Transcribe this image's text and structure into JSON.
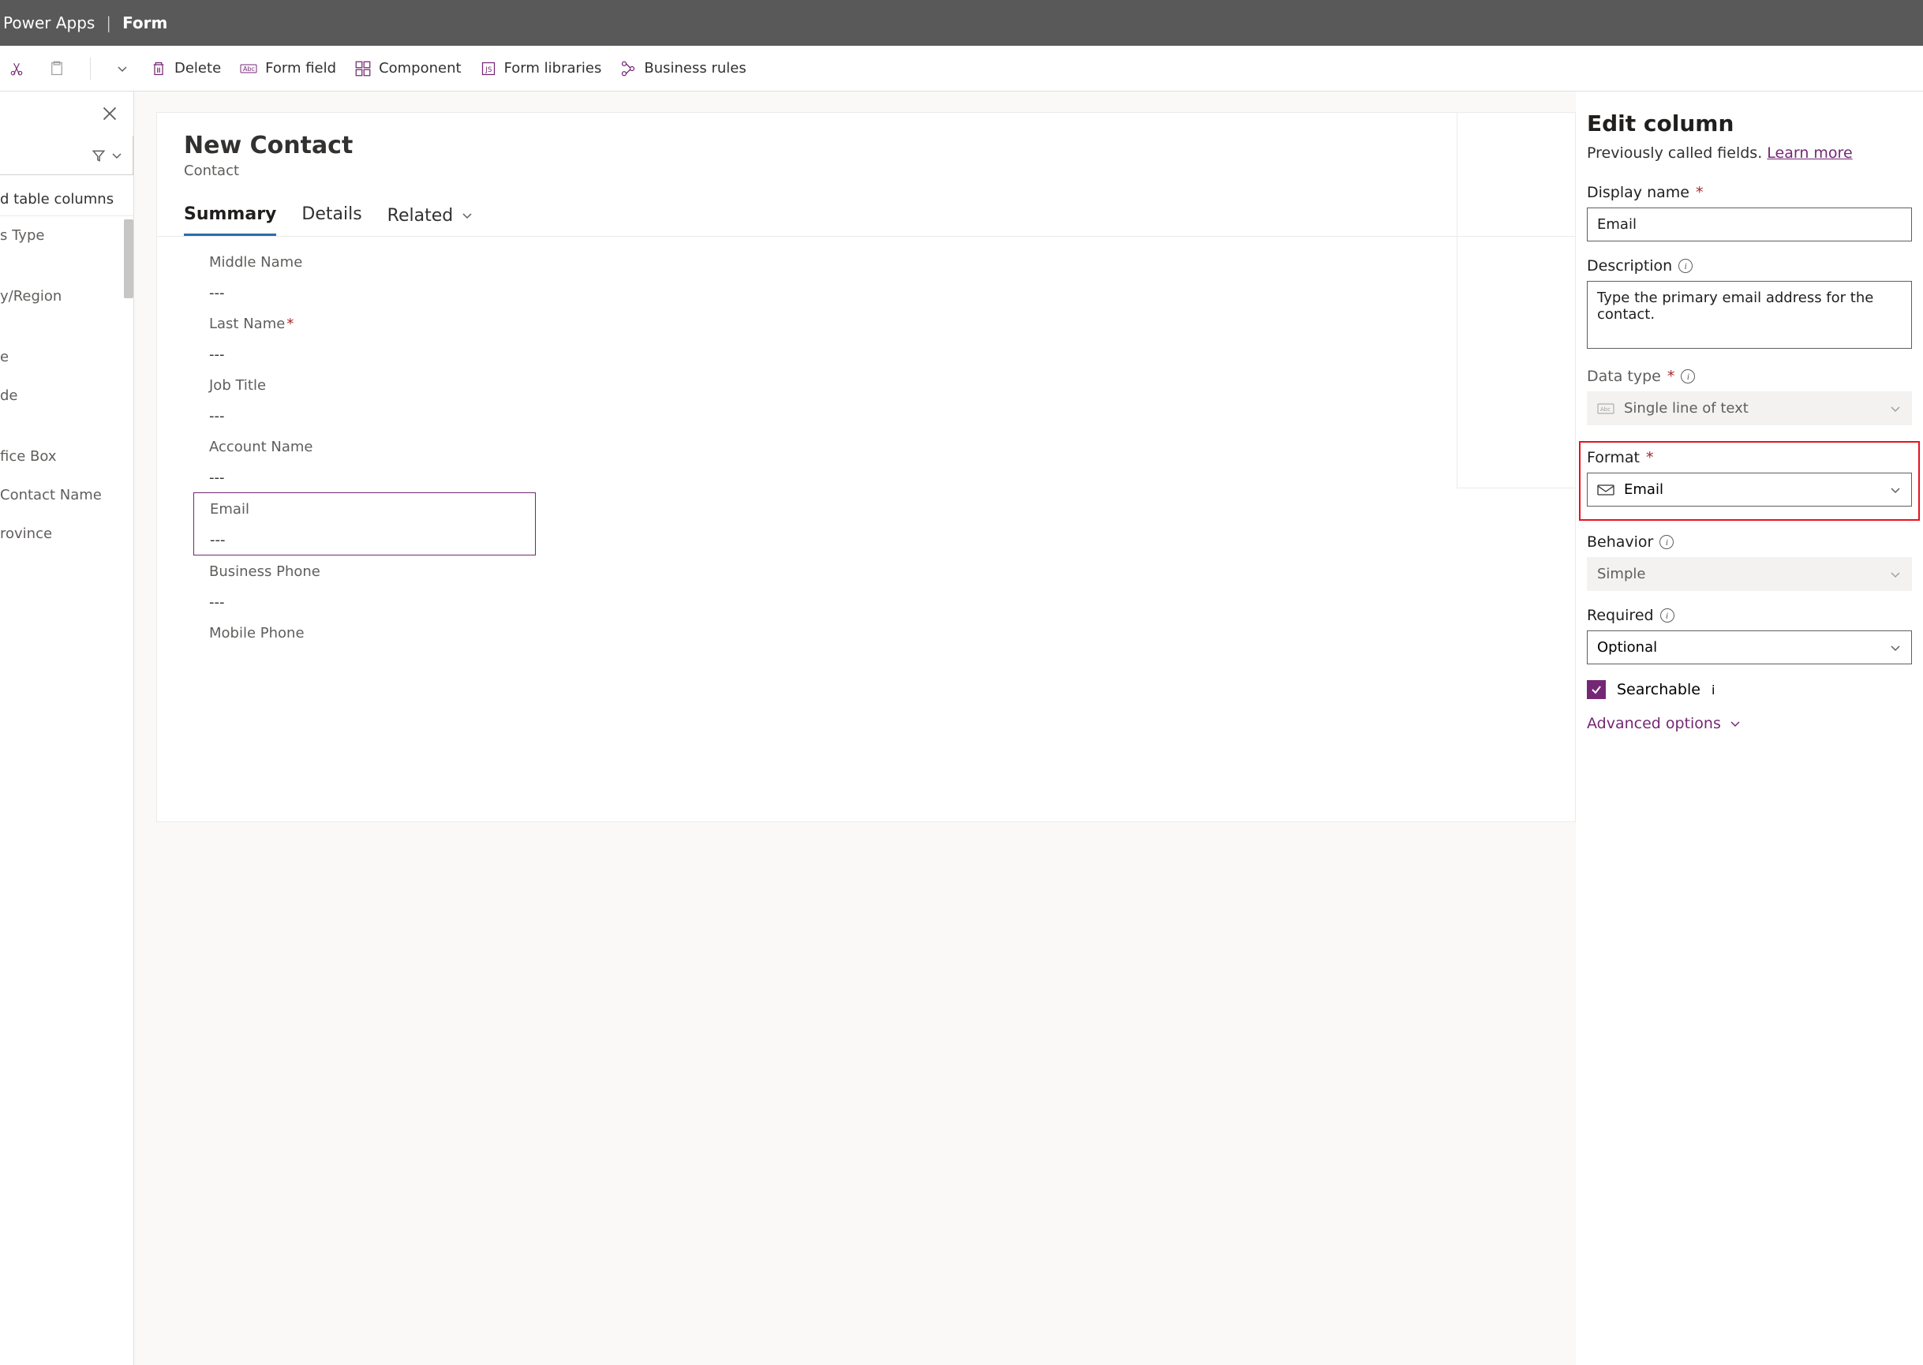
{
  "titlebar": {
    "app": "Power Apps",
    "section": "Form"
  },
  "toolbar": {
    "delete": "Delete",
    "formfield": "Form field",
    "component": "Component",
    "formlibraries": "Form libraries",
    "businessrules": "Business rules"
  },
  "leftpanel": {
    "section_label": "d table columns",
    "items": [
      "s Type",
      "",
      "y/Region",
      "",
      "e",
      "de",
      "",
      "fice Box",
      "Contact Name",
      "rovince"
    ]
  },
  "form": {
    "title": "New Contact",
    "subtitle": "Contact",
    "tabs": {
      "summary": "Summary",
      "details": "Details",
      "related": "Related"
    },
    "fields": [
      {
        "label": "Middle Name",
        "value": "---",
        "required": false,
        "selected": false
      },
      {
        "label": "Last Name",
        "value": "---",
        "required": true,
        "selected": false
      },
      {
        "label": "Job Title",
        "value": "---",
        "required": false,
        "selected": false
      },
      {
        "label": "Account Name",
        "value": "---",
        "required": false,
        "selected": false
      },
      {
        "label": "Email",
        "value": "---",
        "required": false,
        "selected": true
      },
      {
        "label": "Business Phone",
        "value": "---",
        "required": false,
        "selected": false
      },
      {
        "label": "Mobile Phone",
        "value": "",
        "required": false,
        "selected": false
      }
    ]
  },
  "editcolumn": {
    "title": "Edit column",
    "subtitle": "Previously called fields. ",
    "learnmore": "Learn more",
    "displayname_label": "Display name",
    "displayname_value": "Email",
    "description_label": "Description",
    "description_value": "Type the primary email address for the contact.",
    "datatype_label": "Data type",
    "datatype_value": "Single line of text",
    "format_label": "Format",
    "format_value": "Email",
    "behavior_label": "Behavior",
    "behavior_value": "Simple",
    "required_label": "Required",
    "required_value": "Optional",
    "searchable_label": "Searchable",
    "advanced": "Advanced options"
  }
}
